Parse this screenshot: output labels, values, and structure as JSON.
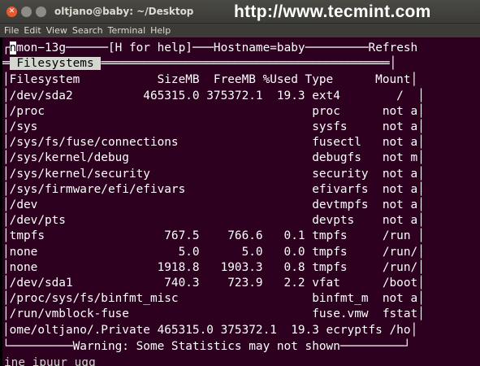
{
  "window": {
    "title": "oltjano@baby: ~/Desktop",
    "watermark": "http://www.tecmint.com",
    "menu": [
      "File",
      "Edit",
      "View",
      "Search",
      "Terminal",
      "Help"
    ]
  },
  "nmon": {
    "header": {
      "corner": "┌",
      "cursor": "n",
      "text": "mon−13g──────[H for help]───Hostname=baby─────────Refresh"
    },
    "section_prefix": "═",
    "section_label": " Filesystems ",
    "section_suffix": "═════════════════════════════════════════│",
    "columns_line": "│Filesystem           SizeMB  FreeMB %Used Type      Mount│",
    "rows": [
      "│/dev/sda2          465315.0 375372.1  19.3 ext4        /  │",
      "│/proc                                      proc      not a│",
      "│/sys                                       sysfs     not a│",
      "│/sys/fs/fuse/connections                   fusectl   not a│",
      "│/sys/kernel/debug                          debugfs   not m│",
      "│/sys/kernel/security                       security  not a│",
      "│/sys/firmware/efi/efivars                  efivarfs  not a│",
      "│/dev                                       devtmpfs  not a│",
      "│/dev/pts                                   devpts    not a│",
      "│tmpfs                 767.5    766.6   0.1 tmpfs     /run │",
      "│none                    5.0      5.0   0.0 tmpfs     /run/│",
      "│none                 1918.8   1903.3   0.8 tmpfs     /run/│",
      "│/dev/sda1             740.3    723.9   2.2 vfat      /boot│",
      "│/proc/sys/fs/binfmt_misc                   binfmt_m  not a│",
      "│/run/vmblock-fuse                          fuse.vmw  fstat│",
      "│ome/oltjano/.Private 465315.0 375372.1  19.3 ecryptfs /ho│"
    ],
    "footer": "└─────────Warning: Some Statistics may not shown─────────┘",
    "below_fragment": "ine ipuur uqq"
  }
}
